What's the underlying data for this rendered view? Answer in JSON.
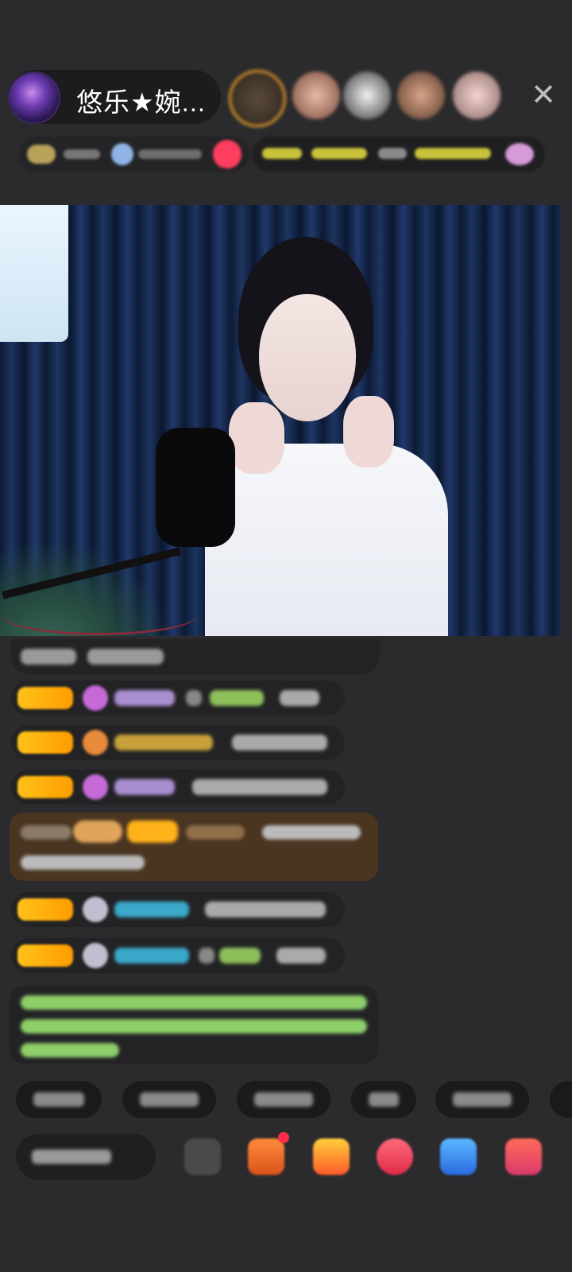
{
  "header": {
    "anchor_name": "悠乐★婉...",
    "close_icon": "close-icon",
    "viewer_count_shown": 5
  },
  "colors": {
    "background": "#2b2b2d",
    "badge_gold": "#ffc21a",
    "highlight_row": "#4a3521",
    "chat_green_text": "#8fcf6a"
  },
  "chat": {
    "message_count": 9
  },
  "quick_replies": {
    "count": 5
  },
  "bottom_bar": {
    "icons": [
      "input-field",
      "emoji-icon",
      "gift-box-icon",
      "treasure-box-icon",
      "heart-icon",
      "game-icon",
      "store-icon"
    ]
  }
}
